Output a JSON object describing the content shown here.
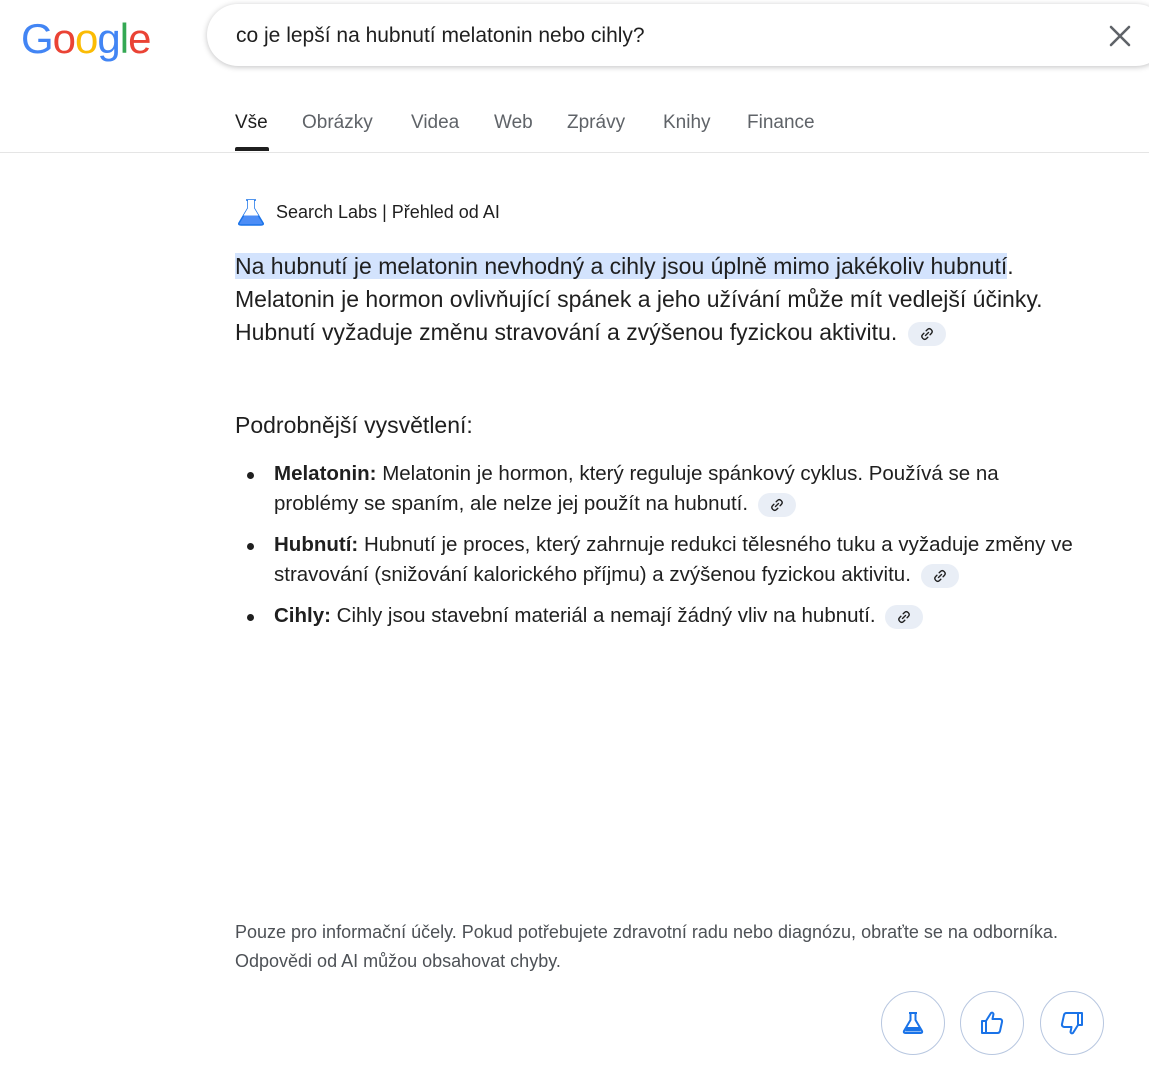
{
  "logo": {
    "text": "Google"
  },
  "search": {
    "query": "co je lepší na hubnutí melatonin nebo cihly?"
  },
  "tabs": [
    {
      "label": "Vše",
      "active": true
    },
    {
      "label": "Obrázky"
    },
    {
      "label": "Videa"
    },
    {
      "label": "Web"
    },
    {
      "label": "Zprávy"
    },
    {
      "label": "Knihy"
    },
    {
      "label": "Finance"
    }
  ],
  "ai_overview": {
    "header": "Search Labs | Přehled od AI",
    "summary_highlight": "Na hubnutí je melatonin nevhodný a cihly jsou úplně mimo jakékoliv hubnutí",
    "summary_rest": ". Melatonin je hormon ovlivňující spánek a jeho užívání může mít vedlejší účinky. Hubnutí vyžaduje změnu stravování a zvýšenou fyzickou aktivitu.",
    "details_heading": "Podrobnější vysvětlení:",
    "items": [
      {
        "term": "Melatonin:",
        "text": " Melatonin je hormon, který reguluje spánkový cyklus. Používá se na problémy se spaním, ale nelze jej použít na hubnutí."
      },
      {
        "term": "Hubnutí:",
        "text": " Hubnutí je proces, který zahrnuje redukci tělesného tuku a vyžaduje změny ve stravování (snižování kalorického příjmu) a zvýšenou fyzickou aktivitu."
      },
      {
        "term": "Cihly:",
        "text": " Cihly jsou stavební materiál a nemají žádný vliv na hubnutí."
      }
    ],
    "disclaimer": "Pouze pro informační účely. Pokud potřebujete zdravotní radu nebo diagnózu, obraťte se na odborníka. Odpovědi od AI můžou obsahovat chyby."
  },
  "colors": {
    "highlight": "#d3e3fd",
    "accent": "#1a73e8"
  }
}
